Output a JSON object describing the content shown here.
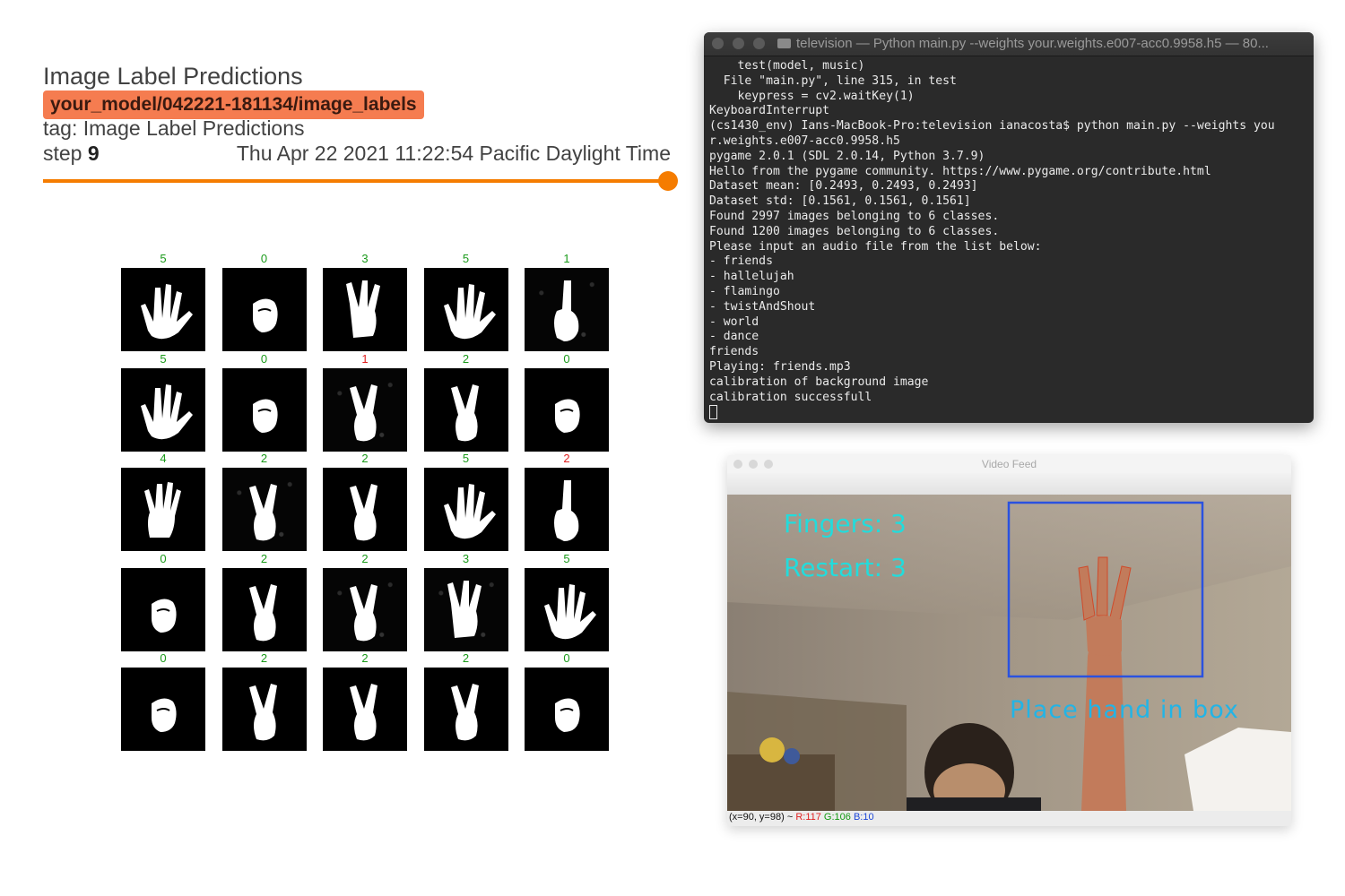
{
  "tensorboard": {
    "title": "Image Label Predictions",
    "run": "your_model/042221-181134/image_labels",
    "tag": "tag: Image Label Predictions",
    "step_label": "step",
    "step_value": "9",
    "timestamp": "Thu Apr 22 2021 11:22:54 Pacific Daylight Time",
    "accent_color": "#f57c00",
    "run_chip_color": "#f57c50",
    "slider_position": 1.0,
    "grid": [
      {
        "label": "5",
        "correct": true,
        "shape": "five"
      },
      {
        "label": "0",
        "correct": true,
        "shape": "fist"
      },
      {
        "label": "3",
        "correct": true,
        "shape": "three"
      },
      {
        "label": "5",
        "correct": true,
        "shape": "five"
      },
      {
        "label": "1",
        "correct": true,
        "shape": "one",
        "noisy": true
      },
      {
        "label": "5",
        "correct": true,
        "shape": "five"
      },
      {
        "label": "0",
        "correct": true,
        "shape": "fist"
      },
      {
        "label": "1",
        "correct": false,
        "shape": "two",
        "noisy": true
      },
      {
        "label": "2",
        "correct": true,
        "shape": "two"
      },
      {
        "label": "0",
        "correct": true,
        "shape": "fist"
      },
      {
        "label": "4",
        "correct": true,
        "shape": "four"
      },
      {
        "label": "2",
        "correct": true,
        "shape": "two",
        "noisy": true
      },
      {
        "label": "2",
        "correct": true,
        "shape": "two"
      },
      {
        "label": "5",
        "correct": true,
        "shape": "five"
      },
      {
        "label": "2",
        "correct": false,
        "shape": "one"
      },
      {
        "label": "0",
        "correct": true,
        "shape": "fist"
      },
      {
        "label": "2",
        "correct": true,
        "shape": "two"
      },
      {
        "label": "2",
        "correct": true,
        "shape": "two",
        "noisy": true
      },
      {
        "label": "3",
        "correct": true,
        "shape": "three",
        "noisy": true
      },
      {
        "label": "5",
        "correct": true,
        "shape": "five"
      },
      {
        "label": "0",
        "correct": true,
        "shape": "fist"
      },
      {
        "label": "2",
        "correct": true,
        "shape": "two"
      },
      {
        "label": "2",
        "correct": true,
        "shape": "two"
      },
      {
        "label": "2",
        "correct": true,
        "shape": "two"
      },
      {
        "label": "0",
        "correct": true,
        "shape": "fist"
      }
    ]
  },
  "terminal": {
    "title": "television — Python main.py --weights your.weights.e007-acc0.9958.h5 — 80...",
    "lines": [
      "    test(model, music)",
      "  File \"main.py\", line 315, in test",
      "    keypress = cv2.waitKey(1)",
      "KeyboardInterrupt",
      "(cs1430_env) Ians-MacBook-Pro:television ianacosta$ python main.py --weights you",
      "r.weights.e007-acc0.9958.h5",
      "pygame 2.0.1 (SDL 2.0.14, Python 3.7.9)",
      "Hello from the pygame community. https://www.pygame.org/contribute.html",
      "Dataset mean: [0.2493, 0.2493, 0.2493]",
      "Dataset std: [0.1561, 0.1561, 0.1561]",
      "Found 2997 images belonging to 6 classes.",
      "Found 1200 images belonging to 6 classes.",
      "Please input an audio file from the list below:",
      "- friends",
      "- hallelujah",
      "- flamingo",
      "- twistAndShout",
      "- world",
      "- dance",
      "friends",
      "Playing: friends.mp3",
      "calibration of background image",
      "calibration successfull"
    ]
  },
  "video": {
    "title": "Video Feed",
    "fingers_text": "Fingers: 3",
    "restart_text": "Restart: 3",
    "hint_text": "Place hand in box",
    "overlay_text_color": "#22dcdc",
    "box_color": "#2a52e0",
    "status": {
      "coords": "(x=90, y=98) ~",
      "r": "R:117",
      "g": "G:106",
      "b": "B:10"
    }
  }
}
